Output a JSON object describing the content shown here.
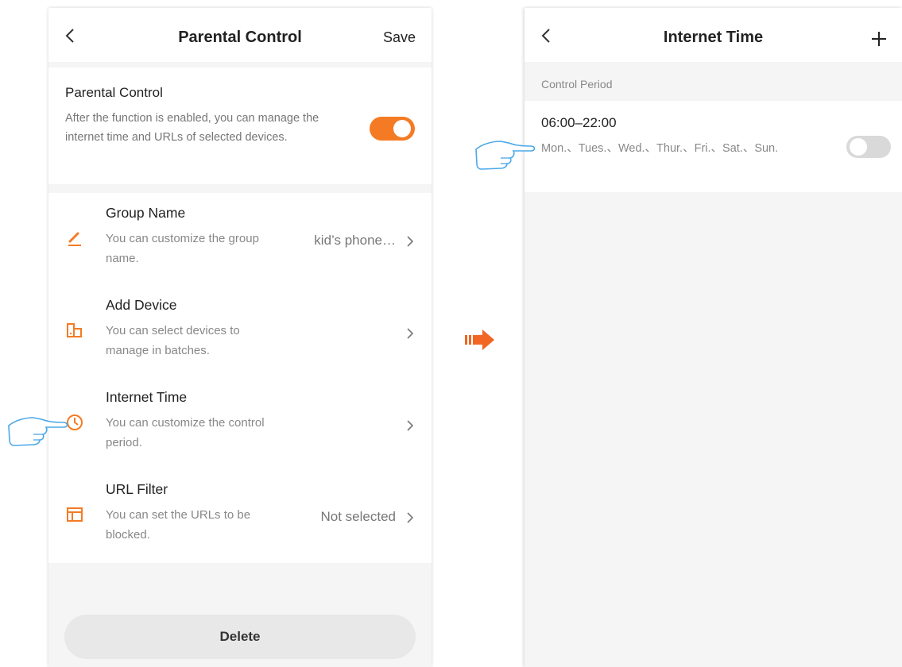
{
  "left_screen": {
    "header": {
      "title": "Parental Control",
      "save_label": "Save"
    },
    "parental_control": {
      "title": "Parental Control",
      "description": "After the function is enabled, you can manage the internet time and URLs of selected devices.",
      "enabled": true
    },
    "settings": [
      {
        "title": "Group Name",
        "description": "You can customize the group name.",
        "value": "kid’s phone…",
        "icon": "pencil-icon"
      },
      {
        "title": "Add Device",
        "description": "You can select devices to manage in batches.",
        "value": "",
        "icon": "devices-icon"
      },
      {
        "title": "Internet Time",
        "description": "You can customize the control period.",
        "value": "",
        "icon": "clock-icon"
      },
      {
        "title": "URL Filter",
        "description": "You can set the URLs to be blocked.",
        "value": "Not selected",
        "icon": "browser-window-icon"
      }
    ],
    "delete_label": "Delete"
  },
  "right_screen": {
    "header": {
      "title": "Internet Time"
    },
    "section_label": "Control Period",
    "periods": [
      {
        "time": "06:00–22:00",
        "days": "Mon.、Tues.、Wed.、Thur.、Fri.、Sat.、Sun.",
        "enabled": false
      }
    ]
  },
  "colors": {
    "accent": "#f47b24",
    "hint_hand": "#4aa8e8",
    "background": "#f5f5f5",
    "toggle_off": "#d9d9d9"
  }
}
